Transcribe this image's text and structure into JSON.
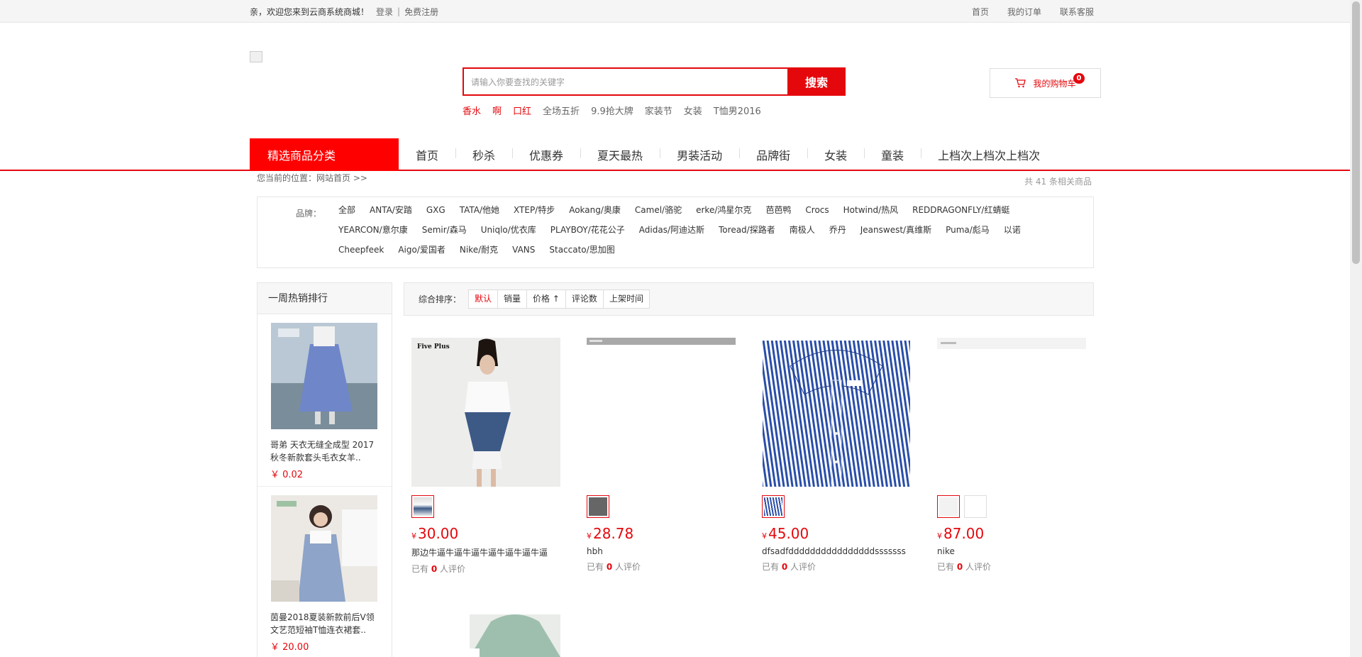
{
  "topbar": {
    "welcome": "亲，欢迎您来到云商系统商城！",
    "login": "登录",
    "sep": "|",
    "register": "免费注册",
    "links": [
      "首页",
      "我的订单",
      "联系客服"
    ]
  },
  "search": {
    "placeholder": "请输入你要查找的关键字",
    "button": "搜索",
    "hotwords": [
      "香水",
      "啊",
      "口红",
      "全场五折",
      "9.9抢大牌",
      "家装节",
      "女装",
      "T恤男2016"
    ]
  },
  "cart": {
    "label": "我的购物车",
    "count": "0"
  },
  "nav": {
    "category": "精选商品分类",
    "items": [
      "首页",
      "秒杀",
      "优惠券",
      "夏天最热",
      "男装活动",
      "品牌街",
      "女装",
      "童装",
      "上档次上档次上档次"
    ]
  },
  "breadcrumb": "您当前的位置：网站首页 >>",
  "total": "共 41 条相关商品",
  "brands": {
    "label": "品牌：",
    "items": [
      "全部",
      "ANTA/安踏",
      "GXG",
      "TATA/他她",
      "XTEP/特步",
      "Aokang/奥康",
      "Camel/骆驼",
      "erke/鸿星尔克",
      "芭芭鸭",
      "Crocs",
      "Hotwind/热风",
      "REDDRAGONFLY/红蜻蜓",
      "YEARCON/意尔康",
      "Semir/森马",
      "Uniqlo/优衣库",
      "PLAYBOY/花花公子",
      "Adidas/阿迪达斯",
      "Toread/探路者",
      "南极人",
      "乔丹",
      "Jeanswest/真维斯",
      "Puma/彪马",
      "以诺",
      "Cheepfeek",
      "Aigo/爱国者",
      "Nike/耐克",
      "VANS",
      "Staccato/思加图"
    ]
  },
  "sidebar": {
    "title": "一周热销排行",
    "products": [
      {
        "name": "哥弟 天衣无缝全成型 2017秋冬新款套头毛衣女羊..",
        "price": "￥ 0.02"
      },
      {
        "name": "茵曼2018夏装新款前后V领文艺范短袖T恤连衣裙套..",
        "price": "￥ 20.00"
      }
    ]
  },
  "sort": {
    "label": "综合排序：",
    "options": [
      "默认",
      "销量",
      "价格 ↑",
      "评论数",
      "上架时间"
    ]
  },
  "products": [
    {
      "price": "30.00",
      "yen": "¥",
      "title": "那边牛逼牛逼牛逼牛逼牛逼牛逼牛逼",
      "comments_pre": "已有",
      "comments_count": "0",
      "comments_post": "人评价",
      "img_text": "Five Plus"
    },
    {
      "price": "28.78",
      "yen": "¥",
      "title": "hbh",
      "comments_pre": "已有",
      "comments_count": "0",
      "comments_post": "人评价"
    },
    {
      "price": "45.00",
      "yen": "¥",
      "title": "dfsadfddddddddddddddddsssssss",
      "comments_pre": "已有",
      "comments_count": "0",
      "comments_post": "人评价"
    },
    {
      "price": "87.00",
      "yen": "¥",
      "title": "nike",
      "comments_pre": "已有",
      "comments_count": "0",
      "comments_post": "人评价"
    }
  ],
  "colors": {
    "accent": "#e4080d",
    "nav_category_bg": "#ff0000"
  }
}
